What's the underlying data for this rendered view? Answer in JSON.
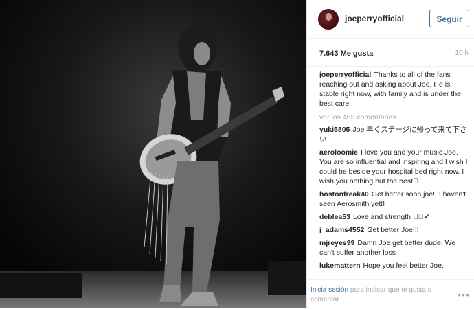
{
  "post": {
    "username": "joeperryofficial",
    "follow_label": "Seguir",
    "likes": "7.643 Me gusta",
    "time_ago": "10 h",
    "caption": "Thanks to all of the fans reaching out and asking about Joe. He is stable right now, with family and is under the best care.",
    "view_all": "ver los 465 comentarios",
    "comments": [
      {
        "user": "yuki5805",
        "text": "Joe 早くステージに帰って来て下さい"
      },
      {
        "user": "aeroloomie",
        "text": "I love you and your music Joe. You are so influential and inspiring and I wish I could be beside your hospital bed right now. I wish you nothing but the best🏼"
      },
      {
        "user": "bostonfreak40",
        "text": "Get better soon joe!! I haven't seen Aerosmith yet!!"
      },
      {
        "user": "deblea53",
        "text": "Love and strength 🏼🏼✔"
      },
      {
        "user": "j_adams4552",
        "text": "Get better Joe!!!"
      },
      {
        "user": "mjreyes99",
        "text": "Damn Joe get better dude. We can't suffer another loss"
      },
      {
        "user": "lukemattern",
        "text": "Hope you feel better Joe."
      }
    ],
    "login_link": "Inicia sesión",
    "login_rest": "para indicar que te gusta o comentar.",
    "more_icon": "more-options-icon",
    "accent_color": "#3f729b"
  }
}
